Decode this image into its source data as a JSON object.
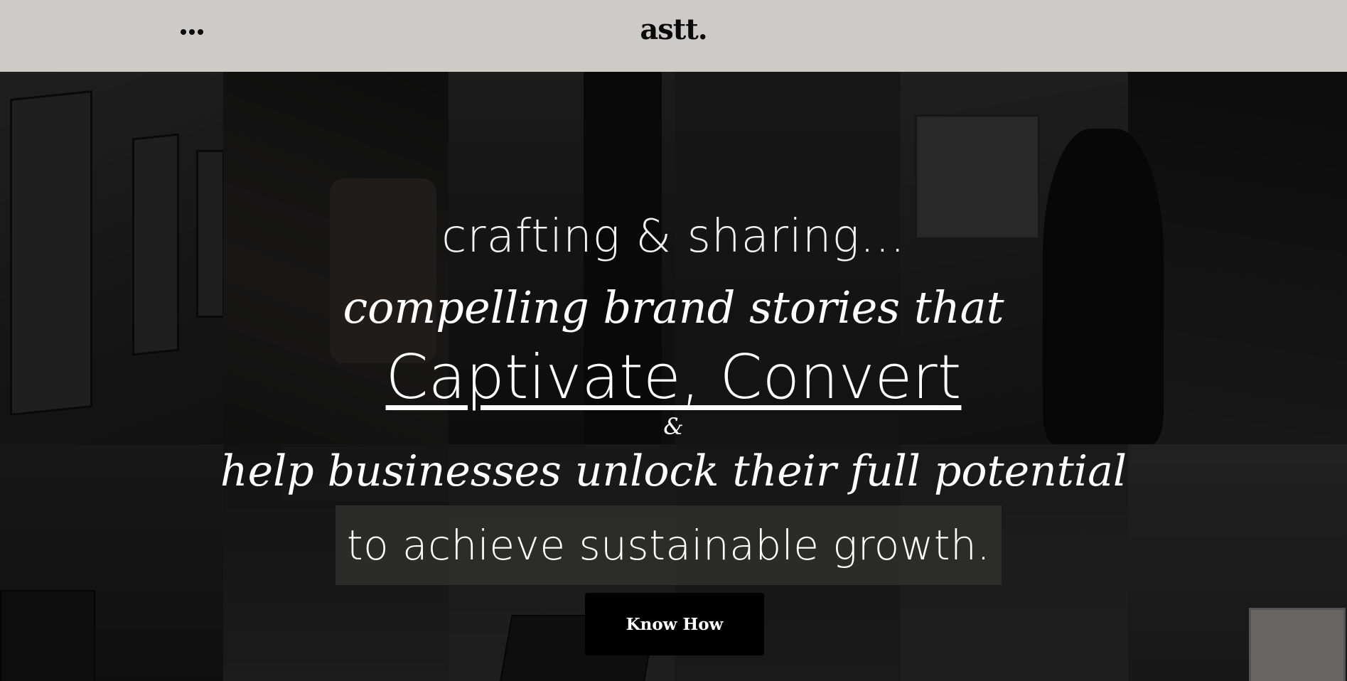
{
  "header": {
    "logo": "astt."
  },
  "hero": {
    "line1": "crafting & sharing...",
    "line2": "compelling brand stories that",
    "line3": "Captivate, Convert ",
    "amp": "&",
    "line4": "help businesses unlock their full potential",
    "line5": "to achieve sustainable growth.",
    "cta_label": "Know How"
  },
  "colors": {
    "header_bg": "#cdcbc7",
    "cta_bg": "#000000",
    "text": "#ffffff"
  }
}
